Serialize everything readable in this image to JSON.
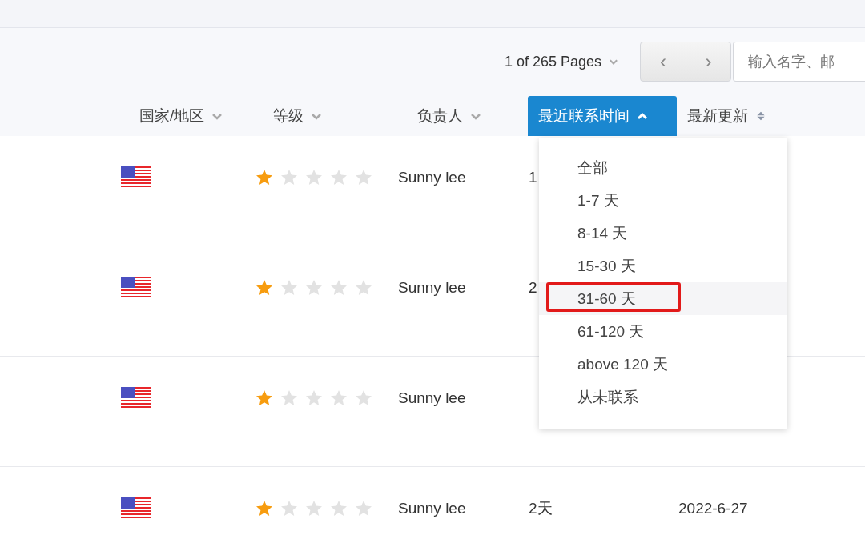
{
  "pagination": {
    "label": "1 of 265 Pages",
    "prev": "‹",
    "next": "›"
  },
  "search": {
    "placeholder": "输入名字、邮"
  },
  "columns": [
    {
      "label": "国家/地区",
      "selected": false,
      "kind": "dropdown"
    },
    {
      "label": "等级",
      "selected": false,
      "kind": "dropdown"
    },
    {
      "label": "负责人",
      "selected": false,
      "kind": "dropdown"
    },
    {
      "label": "最近联系时间",
      "selected": true,
      "kind": "dropdown"
    },
    {
      "label": "最新更新",
      "selected": false,
      "kind": "sort"
    }
  ],
  "rows": [
    {
      "stars": 1,
      "owner": "Sunny lee",
      "contact": "1"
    },
    {
      "stars": 1,
      "owner": "Sunny lee",
      "contact": "2"
    },
    {
      "stars": 1,
      "owner": "Sunny lee"
    },
    {
      "stars": 1,
      "owner": "Sunny lee",
      "contact": "2天",
      "updated": "2022-6-27"
    }
  ],
  "dropdown": {
    "items": [
      {
        "label": "全部",
        "selected": false
      },
      {
        "label": "1-7 天",
        "selected": false
      },
      {
        "label": "8-14 天",
        "selected": false
      },
      {
        "label": "15-30 天",
        "selected": false
      },
      {
        "label": "31-60 天",
        "selected": true
      },
      {
        "label": "61-120 天",
        "selected": false
      },
      {
        "label": "above 120 天",
        "selected": false
      },
      {
        "label": "从未联系",
        "selected": false
      }
    ]
  }
}
